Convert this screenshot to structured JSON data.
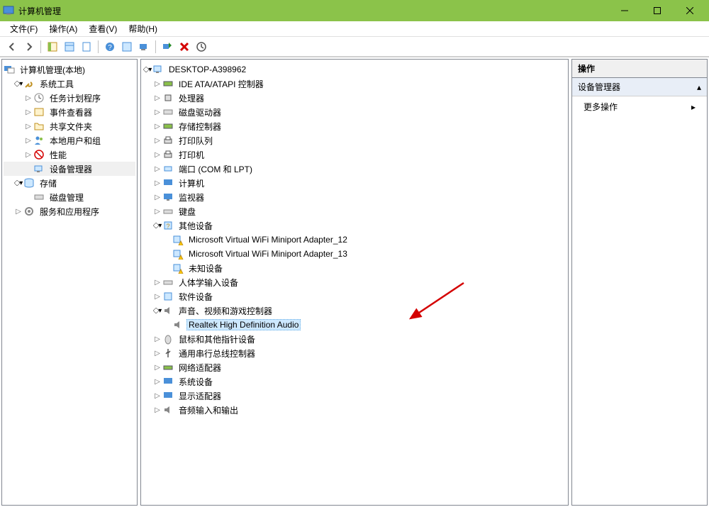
{
  "window": {
    "title": "计算机管理"
  },
  "menu": [
    "文件(F)",
    "操作(A)",
    "查看(V)",
    "帮助(H)"
  ],
  "left_tree": {
    "root": "计算机管理(本地)",
    "system_tools": "系统工具",
    "task_scheduler": "任务计划程序",
    "event_viewer": "事件查看器",
    "shared_folders": "共享文件夹",
    "local_users": "本地用户和组",
    "performance": "性能",
    "device_manager": "设备管理器",
    "storage": "存储",
    "disk_management": "磁盘管理",
    "services_apps": "服务和应用程序"
  },
  "center_tree": {
    "root": "DESKTOP-A398962",
    "ide": "IDE ATA/ATAPI 控制器",
    "cpu": "处理器",
    "disk_drives": "磁盘驱动器",
    "storage_ctrl": "存储控制器",
    "print_queue": "打印队列",
    "printers": "打印机",
    "ports": "端口 (COM 和 LPT)",
    "computer": "计算机",
    "monitors": "监视器",
    "keyboard": "键盘",
    "other_devices": "其他设备",
    "wifi12": "Microsoft Virtual WiFi Miniport Adapter_12",
    "wifi13": "Microsoft Virtual WiFi Miniport Adapter_13",
    "unknown": "未知设备",
    "hid": "人体学输入设备",
    "software": "软件设备",
    "sound": "声音、视频和游戏控制器",
    "realtek": "Realtek High Definition Audio",
    "mouse": "鼠标和其他指针设备",
    "usb": "通用串行总线控制器",
    "network": "网络适配器",
    "system_devices": "系统设备",
    "display": "显示适配器",
    "audio_io": "音频输入和输出"
  },
  "right": {
    "header": "操作",
    "section": "设备管理器",
    "more": "更多操作"
  }
}
